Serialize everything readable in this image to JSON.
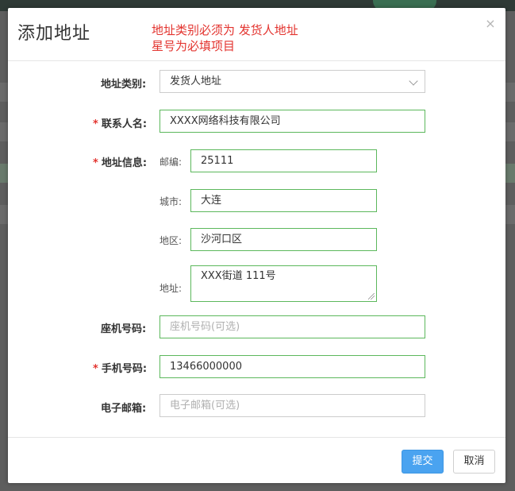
{
  "dialog": {
    "title": "添加地址",
    "note_line1": "地址类别必须为 发货人地址",
    "note_line2": "星号为必填项目",
    "close_glyph": "×"
  },
  "form": {
    "address_type": {
      "label": "地址类别:",
      "value": "发货人地址"
    },
    "contact_name": {
      "required": "*",
      "label": "联系人名:",
      "value": "XXXX网络科技有限公司"
    },
    "address_info": {
      "required": "*",
      "label": "地址信息:",
      "postcode_label": "邮编:",
      "postcode_value": "25111",
      "city_label": "城市:",
      "city_value": "大连",
      "district_label": "地区:",
      "district_value": "沙河口区",
      "address_label": "地址:",
      "address_value": "XXX街道 111号"
    },
    "landline": {
      "label": "座机号码:",
      "placeholder": "座机号码(可选)"
    },
    "mobile": {
      "required": "*",
      "label": "手机号码:",
      "value": "13466000000"
    },
    "email": {
      "label": "电子邮箱:",
      "placeholder": "电子邮箱(可选)"
    }
  },
  "footer": {
    "submit_label": "提交",
    "cancel_label": "取消"
  },
  "colors": {
    "accent_green": "#5cb85c",
    "primary_blue": "#4aa3f0",
    "required_red": "#e3342f"
  }
}
